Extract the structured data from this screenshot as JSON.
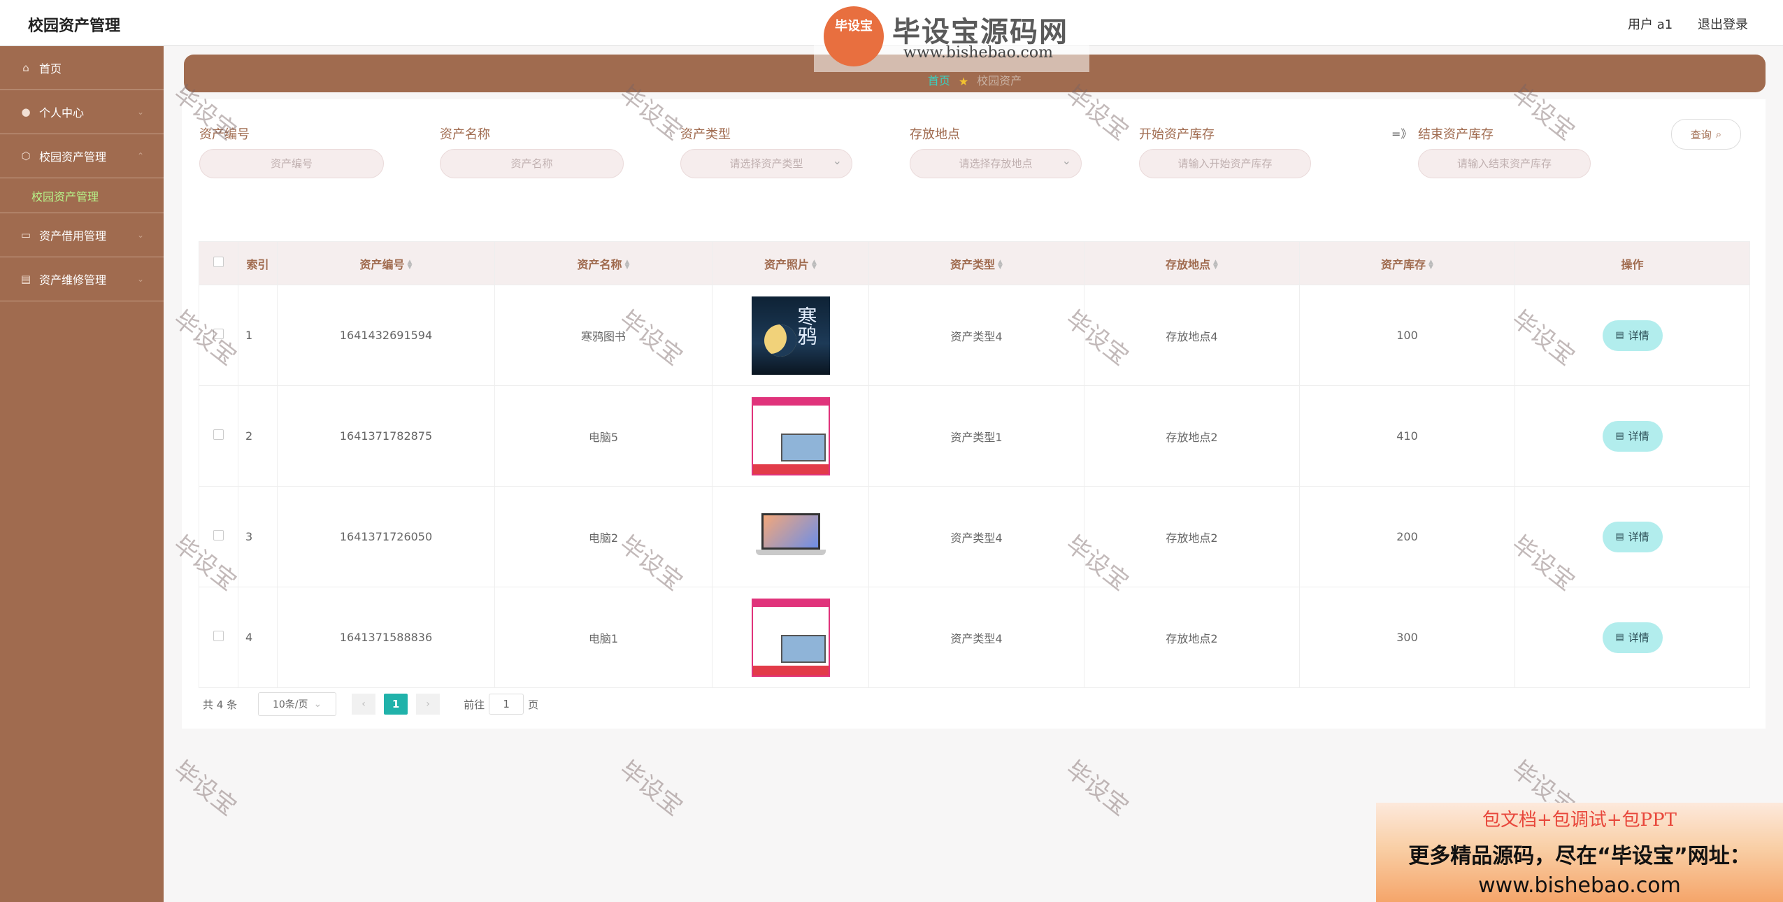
{
  "app": {
    "title": "校园资产管理"
  },
  "header": {
    "user": "用户 a1",
    "logout": "退出登录"
  },
  "sidebar": {
    "items": [
      {
        "label": "首页",
        "icon": "home-icon"
      },
      {
        "label": "个人中心",
        "icon": "user-icon"
      },
      {
        "label": "校园资产管理",
        "icon": "asset-icon",
        "sub": "校园资产管理"
      },
      {
        "label": "资产借用管理",
        "icon": "chat-icon"
      },
      {
        "label": "资产维修管理",
        "icon": "tools-icon"
      }
    ]
  },
  "breadcrumb": {
    "home": "首页",
    "current": "校园资产"
  },
  "search": {
    "fields": [
      {
        "label": "资产编号",
        "placeholder": "资产编号"
      },
      {
        "label": "资产名称",
        "placeholder": "资产名称"
      },
      {
        "label": "资产类型",
        "placeholder": "请选择资产类型"
      },
      {
        "label": "存放地点",
        "placeholder": "请选择存放地点"
      },
      {
        "label": "开始资产库存",
        "placeholder": "请输入开始资产库存"
      },
      {
        "label": "结束资产库存",
        "placeholder": "请输入结束资产库存"
      }
    ],
    "range_arrow": "=》",
    "query": "查询"
  },
  "table": {
    "columns": [
      "索引",
      "资产编号",
      "资产名称",
      "资产照片",
      "资产类型",
      "存放地点",
      "资产库存",
      "操作"
    ],
    "rows": [
      {
        "index": "1",
        "code": "1641432691594",
        "name": "寒鸦图书",
        "photo": "寒鸦",
        "type": "资产类型4",
        "place": "存放地点4",
        "stock": "100",
        "action": "详情"
      },
      {
        "index": "2",
        "code": "1641371782875",
        "name": "电脑5",
        "photo": "",
        "type": "资产类型1",
        "place": "存放地点2",
        "stock": "410",
        "action": "详情"
      },
      {
        "index": "3",
        "code": "1641371726050",
        "name": "电脑2",
        "photo": "",
        "type": "资产类型4",
        "place": "存放地点2",
        "stock": "200",
        "action": "详情"
      },
      {
        "index": "4",
        "code": "1641371588836",
        "name": "电脑1",
        "photo": "",
        "type": "资产类型4",
        "place": "存放地点2",
        "stock": "300",
        "action": "详情"
      }
    ]
  },
  "pagination": {
    "total": "共 4 条",
    "page_size": "10条/页",
    "current_page": "1",
    "goto_prefix": "前往",
    "goto_value": "1",
    "goto_suffix": "页"
  },
  "watermark": {
    "brand": "毕设宝源码网",
    "badge": "毕设宝",
    "url": "www.bishebao.com",
    "repeat": "毕设宝"
  },
  "promo": {
    "line1": "包文档+包调试+包PPT",
    "line2": "更多精品源码，尽在“毕设宝”网址：",
    "line3": "www.bishebao.com"
  },
  "colors": {
    "sidebar": "#a06b4f",
    "accent": "#20b2aa",
    "detail_button": "#b2eded",
    "sub_active": "#b7f58a"
  }
}
